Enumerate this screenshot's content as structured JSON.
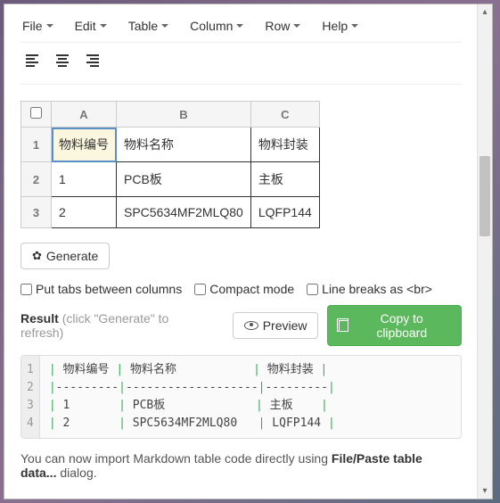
{
  "menu": {
    "file": "File",
    "edit": "Edit",
    "table": "Table",
    "column": "Column",
    "row": "Row",
    "help": "Help"
  },
  "sheet": {
    "cols": [
      "A",
      "B",
      "C"
    ],
    "rows": [
      {
        "n": "1",
        "cells": [
          "物料编号",
          "物料名称",
          "物料封装"
        ]
      },
      {
        "n": "2",
        "cells": [
          "1",
          "PCB板",
          "主板"
        ]
      },
      {
        "n": "3",
        "cells": [
          "2",
          "SPC5634MF2MLQ80",
          "LQFP144"
        ]
      }
    ],
    "selected": {
      "row": 0,
      "col": 0
    }
  },
  "generate_label": "Generate",
  "options": {
    "tabs": "Put tabs between columns",
    "compact": "Compact mode",
    "br": "Line breaks as <br>"
  },
  "result": {
    "label": "Result",
    "hint": "(click \"Generate\" to refresh)",
    "preview": "Preview",
    "copy": "Copy to clipboard"
  },
  "code_lines": [
    "| 物料编号 | 物料名称           | 物料封装 |",
    "|---------|-------------------|---------|",
    "| 1       | PCB板             | 主板    |",
    "| 2       | SPC5634MF2MLQ80   | LQFP144 |"
  ],
  "note_pre": "You can now import Markdown table code directly using ",
  "note_bold": "File/Paste table data...",
  "note_post": " dialog."
}
